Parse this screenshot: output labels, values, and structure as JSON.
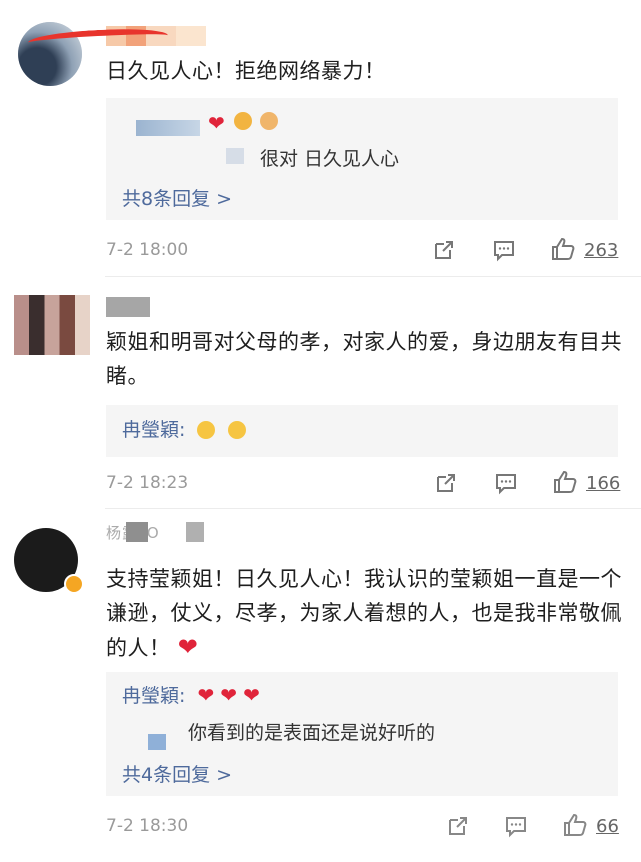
{
  "comments": [
    {
      "text": "日久见人心！拒绝网络暴力！",
      "replies": [
        {
          "user": "",
          "text": "",
          "emojis": [
            "heart",
            "clap",
            "fist"
          ]
        },
        {
          "user": "",
          "text": "很对 日久见人心"
        }
      ],
      "total_replies": "共8条回复 >",
      "time": "7-2 18:00",
      "likes": "263"
    },
    {
      "text": "颖姐和明哥对父母的孝，对家人的爱，身边朋友有目共睹。",
      "replies": [
        {
          "user": "冉瑩穎:",
          "text": "",
          "emojis": [
            "hug",
            "hug"
          ]
        }
      ],
      "time": "7-2 18:23",
      "likes": "166"
    },
    {
      "text": "支持莹颖姐！日久见人心！我认识的莹颖姐一直是一个谦逊，仗义，尽孝，为家人着想的人，也是我非常敬佩的人！",
      "username_fragment": "杨露LO",
      "replies": [
        {
          "user": "冉瑩穎:",
          "text": "",
          "emojis": [
            "heart",
            "heart",
            "heart"
          ]
        },
        {
          "user": "",
          "text": "你看到的是表面还是说好听的"
        }
      ],
      "total_replies": "共4条回复 >",
      "time": "7-2 18:30",
      "likes": "66"
    }
  ]
}
